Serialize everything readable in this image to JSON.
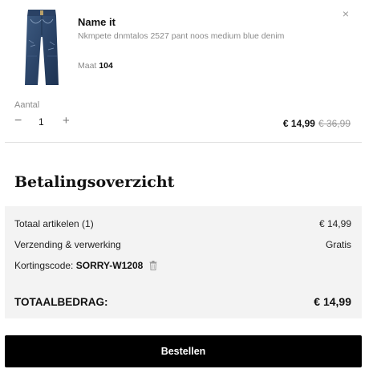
{
  "item": {
    "brand": "Name it",
    "product_name": "Nkmpete dnmtalos 2527 pant noos medium blue denim",
    "size_label": "Maat",
    "size_value": "104",
    "remove_symbol": "×",
    "quantity_label": "Aantal",
    "quantity_minus": "−",
    "quantity_value": "1",
    "quantity_plus": "+",
    "price_current": "€ 14,99",
    "price_old": "€ 36,99"
  },
  "summary": {
    "title": "Betalingsoverzicht",
    "articles_label": "Totaal artikelen (1)",
    "articles_value": "€ 14,99",
    "shipping_label": "Verzending & verwerking",
    "shipping_value": "Gratis",
    "code_label": "Kortingscode:",
    "code_value": "SORRY-W1208",
    "total_label": "TOTAALBEDRAG:",
    "total_value": "€ 14,99"
  },
  "actions": {
    "order_label": "Bestellen"
  },
  "icons": {
    "remove": "close-icon",
    "discount_remove": "trash-icon",
    "product": "jeans-image"
  },
  "colors": {
    "primary_button": "#000000",
    "summary_background": "#f3f3f3",
    "muted_text": "#8a8a8a"
  }
}
